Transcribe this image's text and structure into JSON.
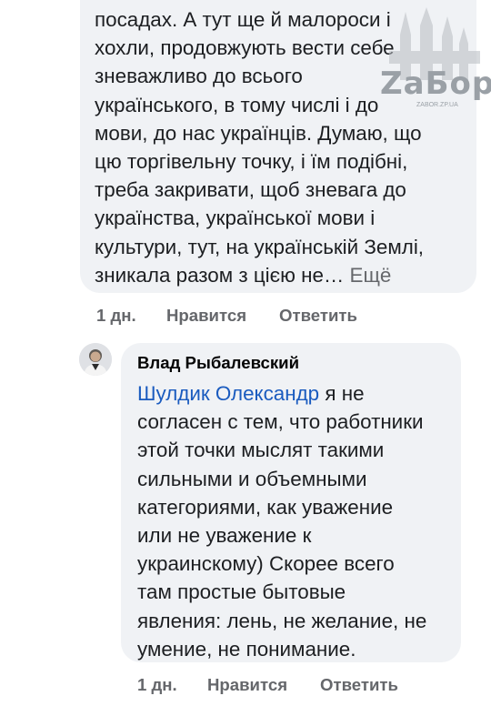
{
  "comment1": {
    "lines": [
      "посадах. А тут ще й малороси і",
      "хохли,  продовжують  вести себе",
      "зневажливо до всього",
      "українського, в тому числі і до",
      "мови, до нас українців. Думаю,  що",
      "цю торгівельну точку, і їм подібні,",
      "треба закривати, щоб зневага  до",
      "українства, української  мови і",
      "культури, тут, на українській Землі,"
    ],
    "last_line": "зникала разом з цією не…",
    "more_label": "Ещё",
    "time": "1 дн.",
    "like_label": "Нравится",
    "reply_label": "Ответить"
  },
  "comment2": {
    "author": "Влад Рыбалевский",
    "mention": "Шулдик Олександр",
    "first_line_rest": " я не",
    "lines": [
      "согласен с тем, что работники",
      "этой точки мыслят такими",
      "сильными и объемными",
      "категориями, как уважение",
      "или не уважение к",
      "украинскому) Скорее всего",
      "там простые бытовые",
      "явления: лень, не желание, не",
      "умение, не понимание."
    ],
    "time": "1 дн.",
    "like_label": "Нравится",
    "reply_label": "Ответить"
  },
  "watermark": {
    "brand": "ZaБор",
    "site": "ZABOR.ZP.UA"
  },
  "icons": {
    "avatar": "user-avatar",
    "watermark": "castle-logo"
  }
}
